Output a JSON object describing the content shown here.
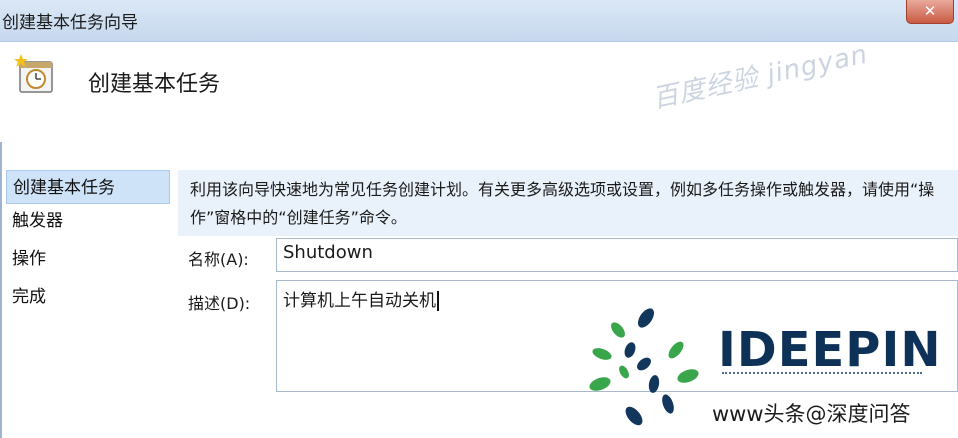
{
  "window": {
    "title": "创建基本任务向导",
    "close_glyph": "✕"
  },
  "header": {
    "title": "创建基本任务",
    "watermark": "百度经验 jingyan"
  },
  "nav": {
    "items": [
      {
        "label": "创建基本任务",
        "active": true
      },
      {
        "label": "触发器",
        "active": false
      },
      {
        "label": "操作",
        "active": false
      },
      {
        "label": "完成",
        "active": false
      }
    ]
  },
  "description": {
    "text": "利用该向导快速地为常见任务创建计划。有关更多高级选项或设置，例如多任务操作或触发器，请使用“操作”窗格中的“创建任务”命令。"
  },
  "form": {
    "name_label": "名称(A):",
    "name_value": "Shutdown",
    "desc_label": "描述(D):",
    "desc_value": "计算机上午自动关机"
  },
  "watermark": {
    "brand": "IDEEPIN",
    "credit": "www头条@深度问答"
  },
  "colors": {
    "accent": "#cfe3f8",
    "brand": "#0e3157",
    "logo_green": "#3aa64c",
    "logo_blue": "#12365c"
  },
  "icons": {
    "task": "task-clock-icon",
    "logo": "ideepin-logo-icon"
  }
}
